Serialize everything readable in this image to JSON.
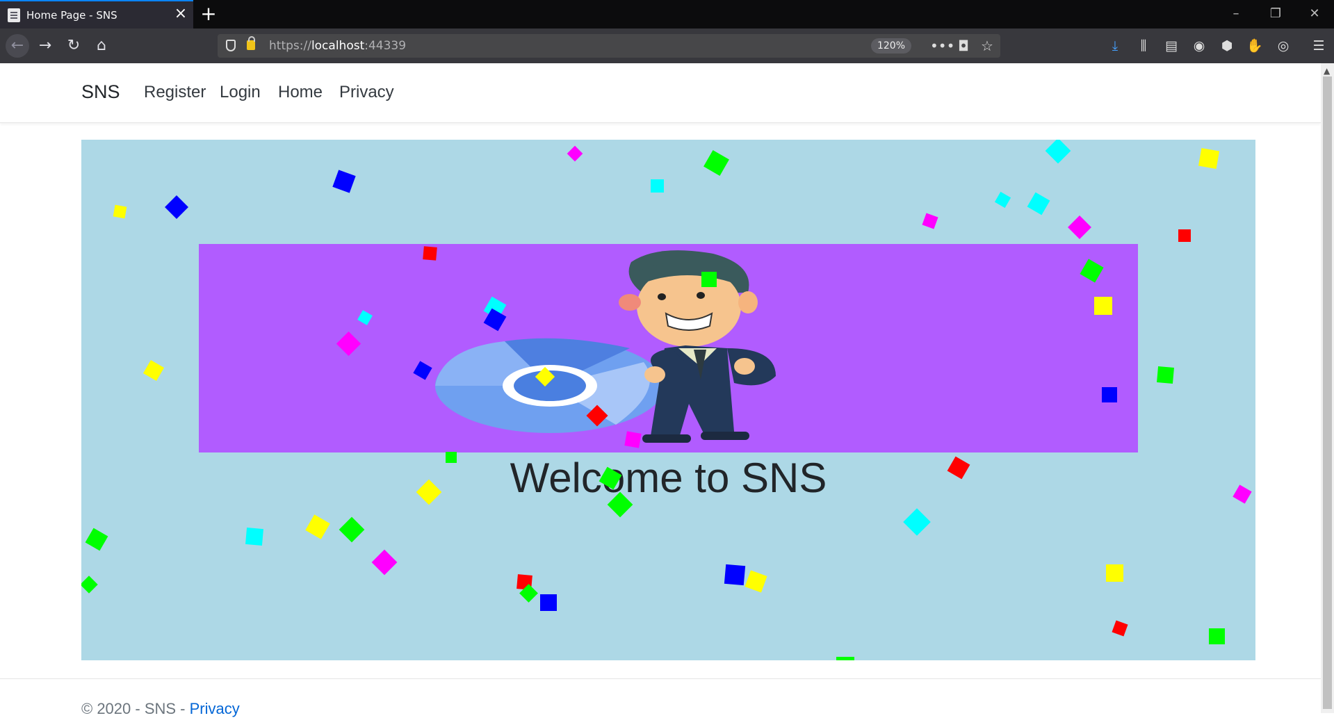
{
  "browser": {
    "tab_title": "Home Page - SNS",
    "url_prefix": "https://",
    "url_host": "localhost",
    "url_port": ":44339",
    "zoom": "120%"
  },
  "nav": {
    "brand": "SNS",
    "links": [
      "Register",
      "Login",
      "Home",
      "Privacy"
    ]
  },
  "hero": {
    "welcome": "Welcome to SNS",
    "background_color": "#add8e6",
    "banner_color": "#b15cff"
  },
  "footer": {
    "text": "© 2020 - SNS - ",
    "link": "Privacy"
  },
  "colors": {
    "confetti": [
      "#ffff00",
      "#0000ff",
      "#ff00ff",
      "#00ffff",
      "#00ff00",
      "#ff0000"
    ]
  }
}
